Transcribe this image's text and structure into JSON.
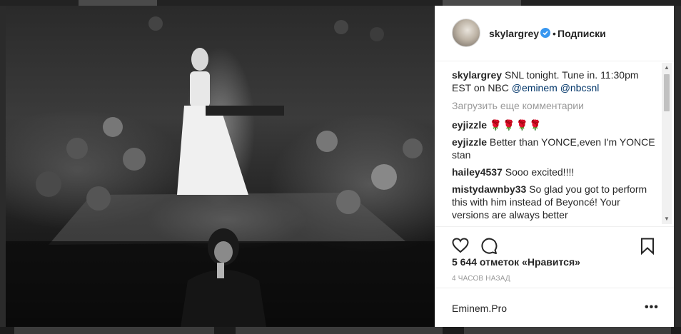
{
  "post": {
    "username": "skylargrey",
    "follow_label": "Подписки",
    "separator": "•",
    "icons": {
      "verified": "verified-badge-icon",
      "like": "heart-icon",
      "comment": "comment-bubble-icon",
      "save": "bookmark-icon",
      "more": "more-options-icon"
    }
  },
  "caption": {
    "username": "skylargrey",
    "text": "SNL tonight. Tune in. 11:30pm EST on NBC",
    "mention1": "@eminem",
    "mention2": "@nbcsnl"
  },
  "load_more_label": "Загрузить еще комментарии",
  "comments": [
    {
      "username": "eyjizzle",
      "text": "🌹🌹🌹🌹"
    },
    {
      "username": "eyjizzle",
      "text": "Better than YONCE,even I'm YONCE stan"
    },
    {
      "username": "hailey4537",
      "text": "Sooo excited!!!!"
    },
    {
      "username": "mistydawnby33",
      "text": "So glad you got to perform this with him instead of Beyoncé! Your versions are always better"
    }
  ],
  "likes_text": "5 644 отметок «Нравится»",
  "timestamp": "4 ЧАСОВ НАЗАД",
  "footer": {
    "comment_field_text": "Eminem.Pro",
    "more_label": "•••"
  },
  "colors": {
    "accent_link": "#003569",
    "verified": "#3897f0",
    "text": "#262626",
    "muted": "#999999"
  }
}
